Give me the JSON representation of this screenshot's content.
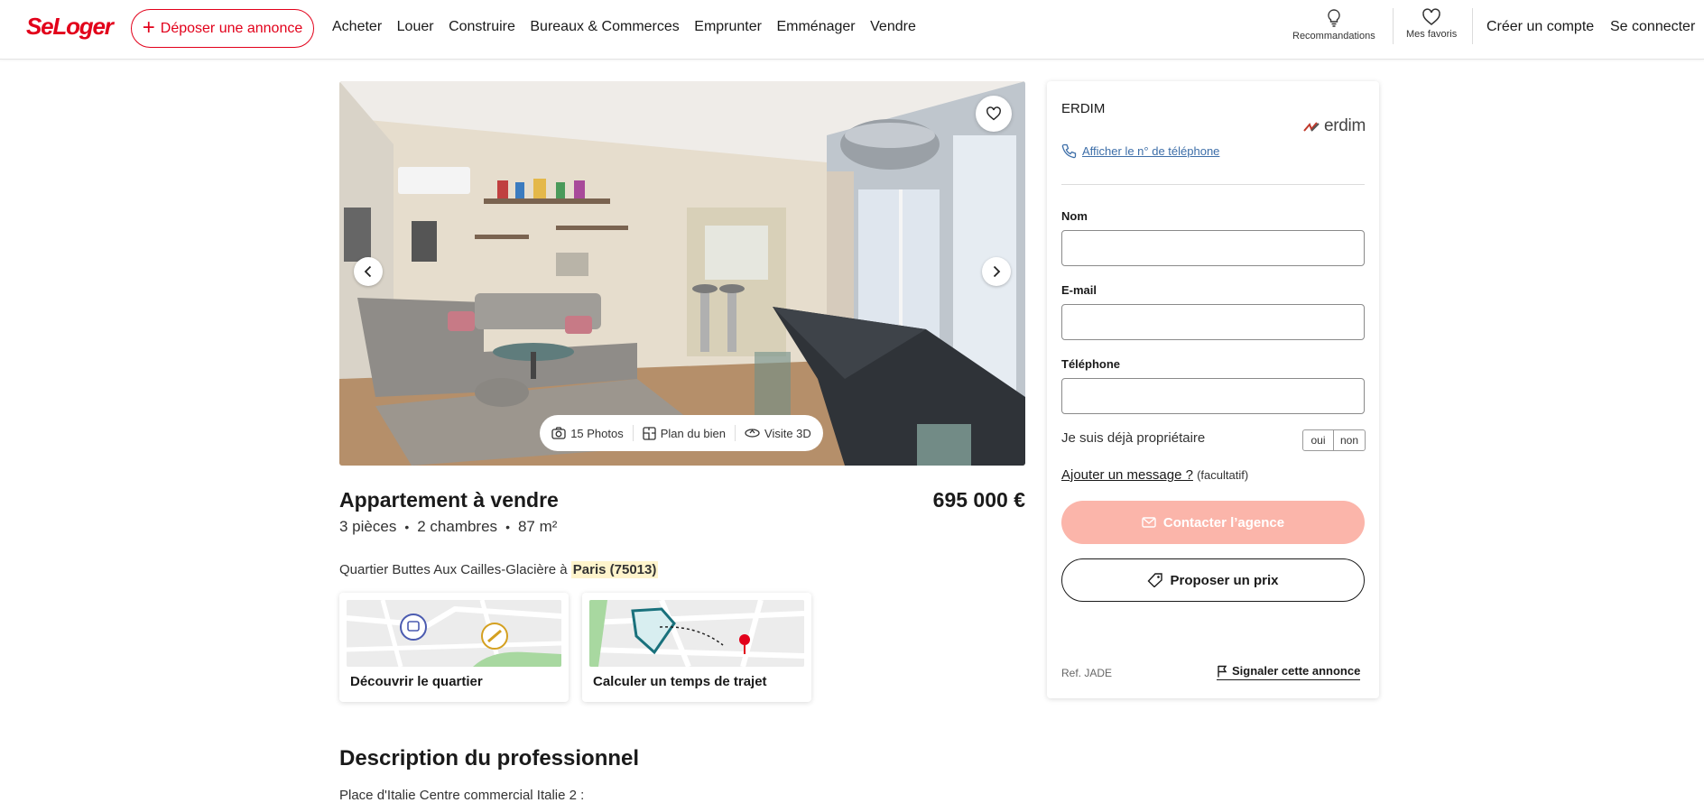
{
  "header": {
    "logo": "SeLoger",
    "deposit_label": "Déposer une annonce",
    "nav": [
      "Acheter",
      "Louer",
      "Construire",
      "Bureaux & Commerces",
      "Emprunter",
      "Emménager",
      "Vendre"
    ],
    "recommendations_label": "Recommandations",
    "favorites_label": "Mes favoris",
    "create_account": "Créer un compte",
    "login": "Se connecter"
  },
  "gallery": {
    "photos_label": "15 Photos",
    "plan_label": "Plan du bien",
    "visit_label": "Visite 3D"
  },
  "listing": {
    "title": "Appartement à vendre",
    "price": "695 000 €",
    "rooms": "3 pièces",
    "bedrooms": "2 chambres",
    "area": "87 m²",
    "location_prefix": "Quartier Buttes Aux Cailles-Glacière à ",
    "city": "Paris (75013)"
  },
  "cards": {
    "neighborhood": "Découvrir le quartier",
    "commute": "Calculer un temps de trajet"
  },
  "description": {
    "title": "Description du professionnel",
    "first_line": "Place d'Italie Centre commercial Italie 2 :"
  },
  "contact": {
    "agency_name": "ERDIM",
    "agency_logo": "erdim",
    "phone_link": "Afficher le n° de téléphone",
    "name_label": "Nom",
    "email_label": "E-mail",
    "phone_label": "Téléphone",
    "owner_question": "Je suis déjà propriétaire",
    "yes": "oui",
    "no": "non",
    "add_message": "Ajouter un message ?",
    "optional": "(facultatif)",
    "contact_button": "Contacter l’agence",
    "offer_button": "Proposer un prix",
    "ref": "Ref. JADE",
    "report": "Signaler cette annonce"
  },
  "colors": {
    "brand": "#e2001a",
    "contact_button": "#fbb5aa",
    "link": "#3d6ea8"
  }
}
